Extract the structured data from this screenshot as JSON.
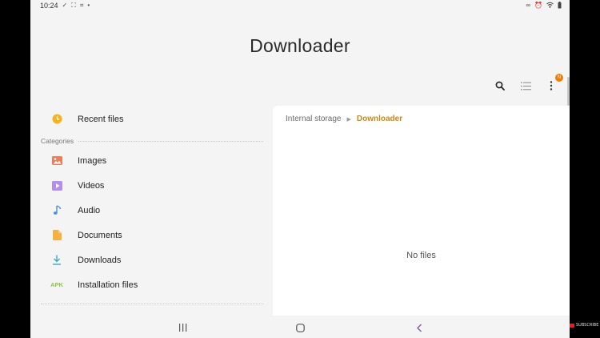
{
  "status_bar": {
    "time": "10:24"
  },
  "app": {
    "title": "Downloader"
  },
  "toolbar": {
    "badge": "N"
  },
  "sidebar": {
    "recent": {
      "label": "Recent files",
      "icon": "clock-icon"
    },
    "categories_label": "Categories",
    "items": [
      {
        "label": "Images",
        "icon": "image-icon",
        "color": "#f07c5c"
      },
      {
        "label": "Videos",
        "icon": "video-icon",
        "color": "#b48ee8"
      },
      {
        "label": "Audio",
        "icon": "music-note-icon",
        "color": "#4a90e2"
      },
      {
        "label": "Documents",
        "icon": "document-icon",
        "color": "#f5b142"
      },
      {
        "label": "Downloads",
        "icon": "download-icon",
        "color": "#3aa9d8"
      },
      {
        "label": "Installation files",
        "icon": "apk-icon",
        "icon_text": "APK",
        "color": "#8cc63f"
      }
    ]
  },
  "content": {
    "breadcrumb": {
      "root": "Internal storage",
      "current": "Downloader"
    },
    "empty_text": "No files"
  },
  "overlay": {
    "watermark": "SUBSCRIBE"
  }
}
